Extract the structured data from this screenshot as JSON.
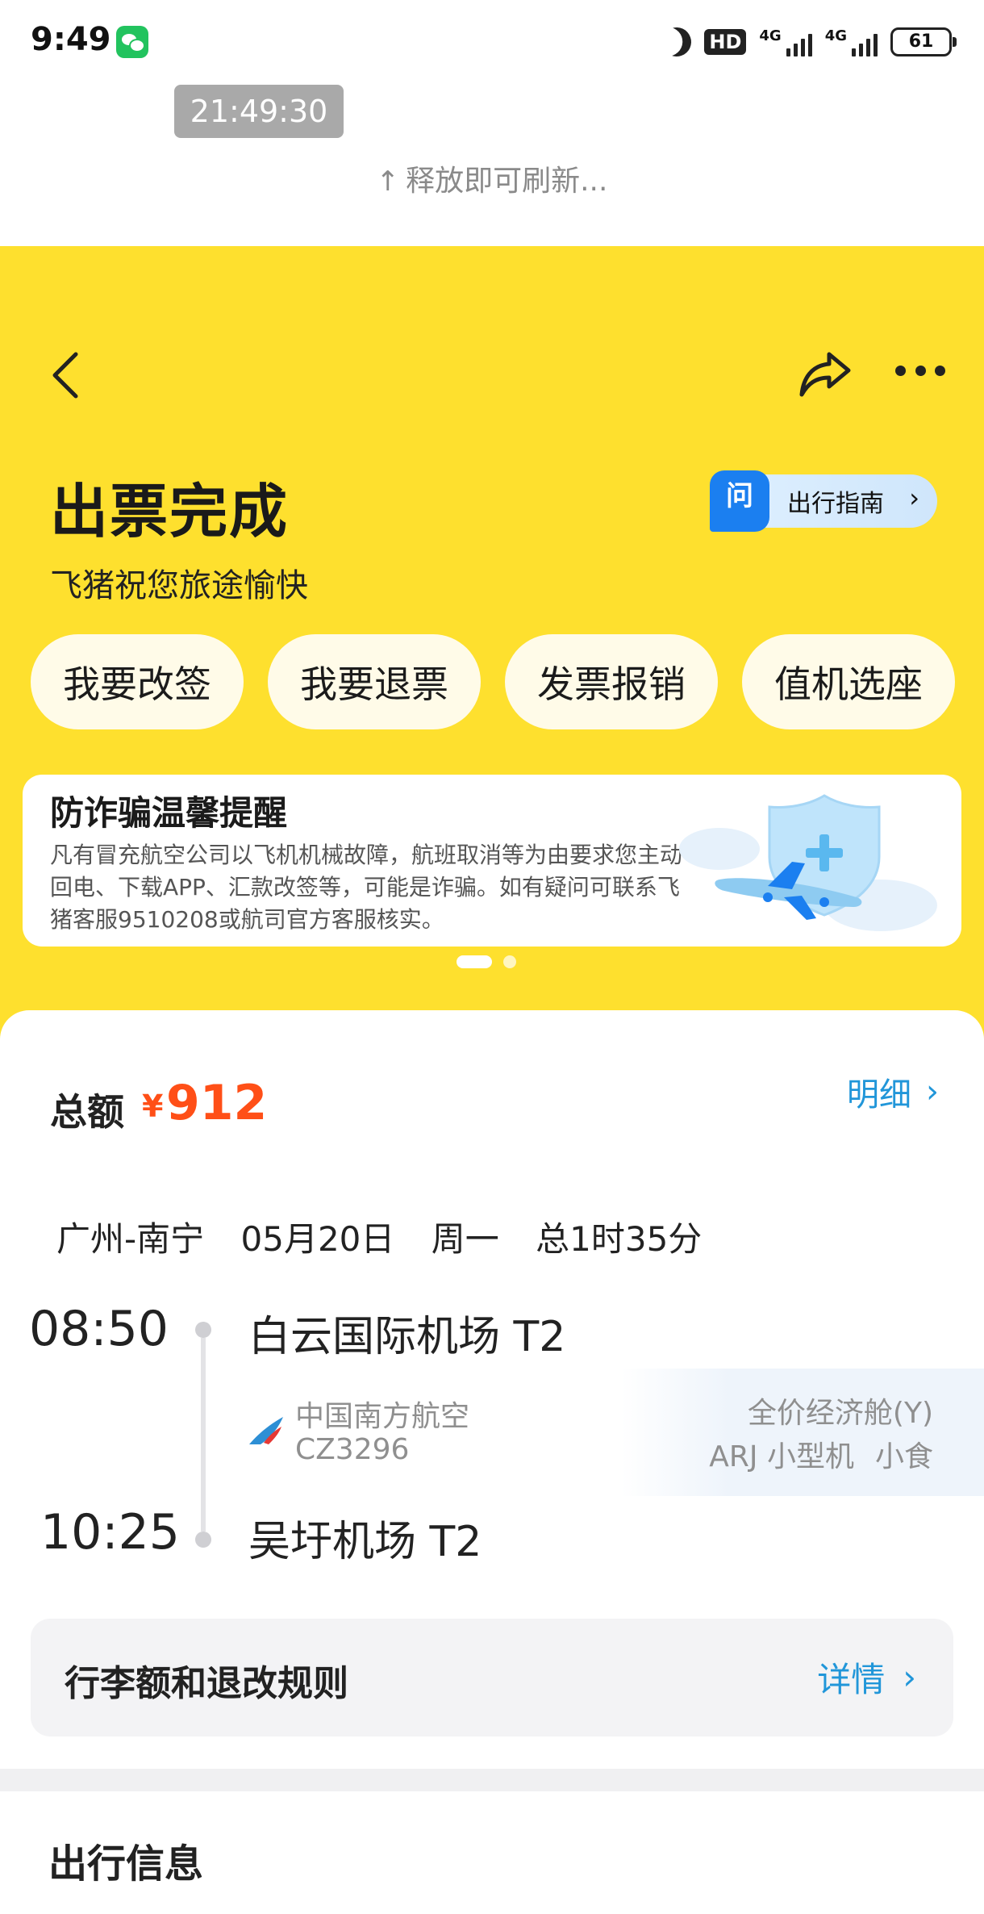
{
  "status_bar": {
    "time": "9:49",
    "hd_label": "HD",
    "net1": "4G",
    "net2": "4G",
    "battery": "61"
  },
  "refresh": {
    "timestamp": "21:49:30",
    "hint": "释放即可刷新...",
    "arrow_icon": "arrow-up-icon"
  },
  "header": {
    "title": "出票完成",
    "subtitle": "飞猪祝您旅途愉快",
    "guide_badge": "问",
    "guide_label": "出行指南",
    "colors": {
      "background": "#fee02e",
      "guide_blue": "#1b7ff0"
    }
  },
  "actions": [
    {
      "label": "我要改签"
    },
    {
      "label": "我要退票"
    },
    {
      "label": "发票报销"
    },
    {
      "label": "值机选座"
    }
  ],
  "notice": {
    "title": "防诈骗温馨提醒",
    "body": "凡有冒充航空公司以飞机机械故障，航班取消等为由要求您主动回电、下载APP、汇款改签等，可能是诈骗。如有疑问可联系飞猪客服9510208或航司官方客服核实。",
    "carousel_count": 2,
    "carousel_active": 0
  },
  "order": {
    "total_label": "总额",
    "currency": "¥",
    "total": "912",
    "detail_link": "明细",
    "accent": "#ff4f17",
    "link_color": "#2196d9"
  },
  "flight": {
    "route": "广州-南宁",
    "date": "05月20日",
    "weekday": "周一",
    "duration": "总1时35分",
    "departure": {
      "time": "08:50",
      "airport": "白云国际机场 T2"
    },
    "arrival": {
      "time": "10:25",
      "airport": "吴圩机场 T2"
    },
    "airline": "中国南方航空",
    "flight_no": "CZ3296",
    "cabin": "全价经济舱(Y)",
    "aircraft": "ARJ 小型机",
    "meal": "小食"
  },
  "rules": {
    "title": "行李额和退改规则",
    "link": "详情"
  },
  "travel_info": {
    "title": "出行信息"
  }
}
